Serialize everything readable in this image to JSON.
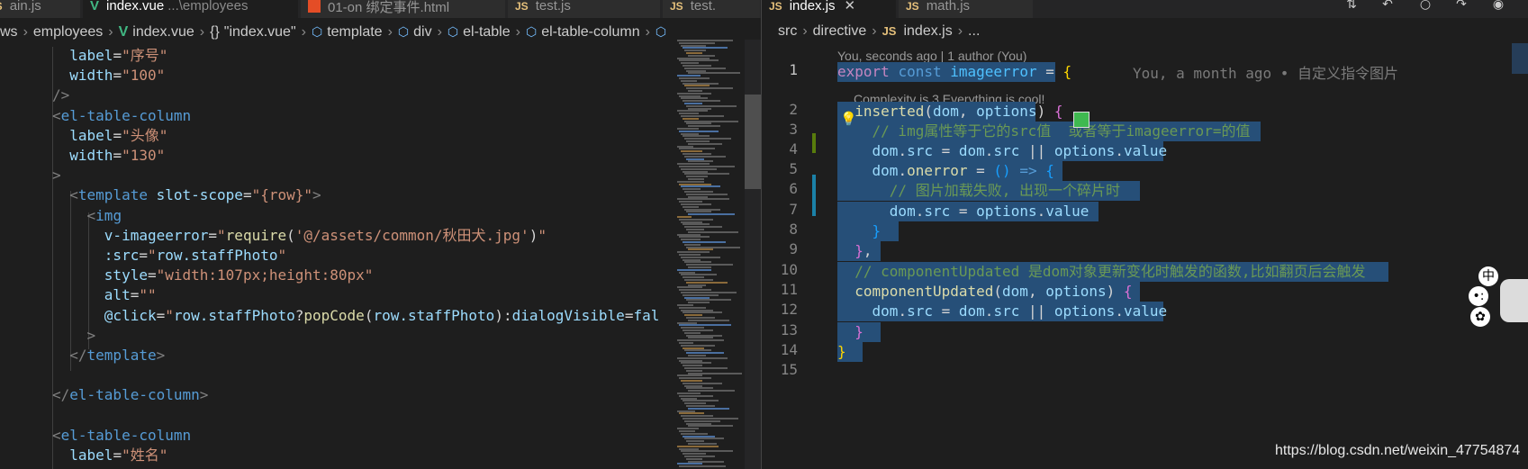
{
  "left_editor": {
    "tabs": [
      {
        "label": "ain.js",
        "sub": "",
        "icon": "js-file-icon",
        "active": false
      },
      {
        "label": "index.vue",
        "sub": "...\\employees",
        "icon": "vue-file-icon",
        "active": true
      },
      {
        "label": "01-on 绑定事件.html",
        "sub": "",
        "icon": "html-file-icon",
        "active": false
      },
      {
        "label": "test.js",
        "sub": "",
        "icon": "js-file-icon",
        "active": false
      },
      {
        "label": "test.",
        "sub": "",
        "icon": "js-file-icon",
        "active": false
      }
    ],
    "breadcrumb": [
      "ws",
      "employees",
      "index.vue",
      "\"index.vue\"",
      "template",
      "div",
      "el-table",
      "el-table-column"
    ],
    "lines": [
      [
        "  ",
        {
          "c": "attr",
          "t": "label"
        },
        {
          "c": "plain",
          "t": "="
        },
        {
          "c": "str",
          "t": "\"序号\""
        }
      ],
      [
        "  ",
        {
          "c": "attr",
          "t": "width"
        },
        {
          "c": "plain",
          "t": "="
        },
        {
          "c": "str",
          "t": "\"100\""
        }
      ],
      [
        {
          "c": "punc",
          "t": "/>"
        }
      ],
      [
        {
          "c": "punc",
          "t": "<"
        },
        {
          "c": "tag",
          "t": "el-table-column"
        }
      ],
      [
        "  ",
        {
          "c": "attr",
          "t": "label"
        },
        {
          "c": "plain",
          "t": "="
        },
        {
          "c": "str",
          "t": "\"头像\""
        }
      ],
      [
        "  ",
        {
          "c": "attr",
          "t": "width"
        },
        {
          "c": "plain",
          "t": "="
        },
        {
          "c": "str",
          "t": "\"130\""
        }
      ],
      [
        {
          "c": "punc",
          "t": ">"
        }
      ],
      [
        "  ",
        {
          "c": "punc",
          "t": "<"
        },
        {
          "c": "tag",
          "t": "template"
        },
        {
          "c": "plain",
          "t": " "
        },
        {
          "c": "attr",
          "t": "slot-scope"
        },
        {
          "c": "plain",
          "t": "="
        },
        {
          "c": "str",
          "t": "\"{row}\""
        },
        {
          "c": "punc",
          "t": ">"
        }
      ],
      [
        "    ",
        {
          "c": "punc",
          "t": "<"
        },
        {
          "c": "tag",
          "t": "img"
        }
      ],
      [
        "      ",
        {
          "c": "attr",
          "t": "v-imageerror"
        },
        {
          "c": "plain",
          "t": "="
        },
        {
          "c": "str",
          "t": "\""
        },
        {
          "c": "fn",
          "t": "require"
        },
        {
          "c": "plain",
          "t": "("
        },
        {
          "c": "str",
          "t": "'@/assets/common/秋田犬.jpg'"
        },
        {
          "c": "plain",
          "t": ")"
        },
        {
          "c": "str",
          "t": "\""
        }
      ],
      [
        "      ",
        {
          "c": "attr",
          "t": ":src"
        },
        {
          "c": "plain",
          "t": "="
        },
        {
          "c": "str",
          "t": "\""
        },
        {
          "c": "var",
          "t": "row.staffPhoto"
        },
        {
          "c": "str",
          "t": "\""
        }
      ],
      [
        "      ",
        {
          "c": "attr",
          "t": "style"
        },
        {
          "c": "plain",
          "t": "="
        },
        {
          "c": "str",
          "t": "\"width:107px;height:80px\""
        }
      ],
      [
        "      ",
        {
          "c": "attr",
          "t": "alt"
        },
        {
          "c": "plain",
          "t": "="
        },
        {
          "c": "str",
          "t": "\"\""
        }
      ],
      [
        "      ",
        {
          "c": "attr",
          "t": "@click"
        },
        {
          "c": "plain",
          "t": "="
        },
        {
          "c": "str",
          "t": "\""
        },
        {
          "c": "var",
          "t": "row.staffPhoto"
        },
        {
          "c": "plain",
          "t": "?"
        },
        {
          "c": "fn",
          "t": "popCode"
        },
        {
          "c": "plain",
          "t": "("
        },
        {
          "c": "var",
          "t": "row.staffPhoto"
        },
        {
          "c": "plain",
          "t": "):"
        },
        {
          "c": "var",
          "t": "dialogVisible"
        },
        {
          "c": "plain",
          "t": "="
        },
        {
          "c": "var",
          "t": "fal"
        }
      ],
      [
        "    ",
        {
          "c": "punc",
          "t": ">"
        }
      ],
      [
        "  ",
        {
          "c": "punc",
          "t": "</"
        },
        {
          "c": "tag",
          "t": "template"
        },
        {
          "c": "punc",
          "t": ">"
        }
      ],
      [
        ""
      ],
      [
        {
          "c": "punc",
          "t": "</"
        },
        {
          "c": "tag",
          "t": "el-table-column"
        },
        {
          "c": "punc",
          "t": ">"
        }
      ],
      [
        ""
      ],
      [
        {
          "c": "punc",
          "t": "<"
        },
        {
          "c": "tag",
          "t": "el-table-column"
        }
      ],
      [
        "  ",
        {
          "c": "attr",
          "t": "label"
        },
        {
          "c": "plain",
          "t": "="
        },
        {
          "c": "str",
          "t": "\"姓名\""
        }
      ]
    ]
  },
  "right_editor": {
    "tabs": [
      {
        "label": "index.js",
        "icon": "js-file-icon",
        "active": true,
        "closable": true
      },
      {
        "label": "math.js",
        "icon": "js-file-icon",
        "active": false,
        "closable": false
      }
    ],
    "breadcrumb": [
      "src",
      "directive",
      "index.js",
      "..."
    ],
    "blame_header": "You, seconds ago | 1 author (You)",
    "blame_inline": "You, a month ago • 自定义指令图片",
    "codelens": "Complexity is 3 Everything is cool!",
    "line_numbers": [
      "1",
      "2",
      "3",
      "4",
      "5",
      "6",
      "7",
      "8",
      "9",
      "10",
      "11",
      "12",
      "13",
      "14",
      "15"
    ],
    "lines": [
      [
        {
          "c": "kwctl",
          "t": "export"
        },
        {
          "c": "plain",
          "t": " "
        },
        {
          "c": "kw",
          "t": "const"
        },
        {
          "c": "plain",
          "t": " "
        },
        {
          "c": "const",
          "t": "imageerror"
        },
        {
          "c": "plain",
          "t": " = "
        },
        {
          "c": "brace1",
          "t": "{"
        }
      ],
      [
        "  ",
        {
          "c": "fn",
          "t": "inserted"
        },
        {
          "c": "plain",
          "t": "("
        },
        {
          "c": "var",
          "t": "dom"
        },
        {
          "c": "plain",
          "t": ", "
        },
        {
          "c": "var",
          "t": "options"
        },
        {
          "c": "plain",
          "t": ") "
        },
        {
          "c": "brace2",
          "t": "{"
        }
      ],
      [
        "    ",
        {
          "c": "cm",
          "t": "// img属性等于它的src值  或者等于imageerror=的值"
        }
      ],
      [
        "    ",
        {
          "c": "var",
          "t": "dom"
        },
        {
          "c": "plain",
          "t": "."
        },
        {
          "c": "var",
          "t": "src"
        },
        {
          "c": "plain",
          "t": " = "
        },
        {
          "c": "var",
          "t": "dom"
        },
        {
          "c": "plain",
          "t": "."
        },
        {
          "c": "var",
          "t": "src"
        },
        {
          "c": "plain",
          "t": " || "
        },
        {
          "c": "var",
          "t": "options"
        },
        {
          "c": "plain",
          "t": "."
        },
        {
          "c": "var",
          "t": "value"
        }
      ],
      [
        "    ",
        {
          "c": "var",
          "t": "dom"
        },
        {
          "c": "plain",
          "t": "."
        },
        {
          "c": "fn",
          "t": "onerror"
        },
        {
          "c": "plain",
          "t": " = "
        },
        {
          "c": "brace3",
          "t": "()"
        },
        {
          "c": "plain",
          "t": " "
        },
        {
          "c": "kw",
          "t": "=>"
        },
        {
          "c": "plain",
          "t": " "
        },
        {
          "c": "brace3",
          "t": "{"
        }
      ],
      [
        "      ",
        {
          "c": "cm",
          "t": "// 图片加载失败, 出现一个碎片时"
        }
      ],
      [
        "      ",
        {
          "c": "var",
          "t": "dom"
        },
        {
          "c": "plain",
          "t": "."
        },
        {
          "c": "var",
          "t": "src"
        },
        {
          "c": "plain",
          "t": " = "
        },
        {
          "c": "var",
          "t": "options"
        },
        {
          "c": "plain",
          "t": "."
        },
        {
          "c": "var",
          "t": "value"
        }
      ],
      [
        "    ",
        {
          "c": "brace3",
          "t": "}"
        }
      ],
      [
        "  ",
        {
          "c": "brace2",
          "t": "}"
        },
        {
          "c": "plain",
          "t": ","
        }
      ],
      [
        "  ",
        {
          "c": "cm",
          "t": "// componentUpdated 是dom对象更新变化时触发的函数,比如翻页后会触发"
        }
      ],
      [
        "  ",
        {
          "c": "fn",
          "t": "componentUpdated"
        },
        {
          "c": "plain",
          "t": "("
        },
        {
          "c": "var",
          "t": "dom"
        },
        {
          "c": "plain",
          "t": ", "
        },
        {
          "c": "var",
          "t": "options"
        },
        {
          "c": "plain",
          "t": ") "
        },
        {
          "c": "brace2",
          "t": "{"
        }
      ],
      [
        "    ",
        {
          "c": "var",
          "t": "dom"
        },
        {
          "c": "plain",
          "t": "."
        },
        {
          "c": "var",
          "t": "src"
        },
        {
          "c": "plain",
          "t": " = "
        },
        {
          "c": "var",
          "t": "dom"
        },
        {
          "c": "plain",
          "t": "."
        },
        {
          "c": "var",
          "t": "src"
        },
        {
          "c": "plain",
          "t": " || "
        },
        {
          "c": "var",
          "t": "options"
        },
        {
          "c": "plain",
          "t": "."
        },
        {
          "c": "var",
          "t": "value"
        }
      ],
      [
        "  ",
        {
          "c": "brace2",
          "t": "}"
        }
      ],
      [
        {
          "c": "brace1",
          "t": "}"
        }
      ],
      [
        ""
      ]
    ]
  },
  "floating_icons": [
    "中",
    "•:",
    "✿"
  ],
  "watermark": "https://blog.csdn.net/weixin_47754874",
  "colors": {
    "selection": "#264f78",
    "editor_bg": "#1e1e1e",
    "tab_active_bg": "#1e1e1e",
    "tab_inactive_bg": "#2d2d2d",
    "git_modified": "#1b81a8",
    "git_added": "#587c0c"
  }
}
